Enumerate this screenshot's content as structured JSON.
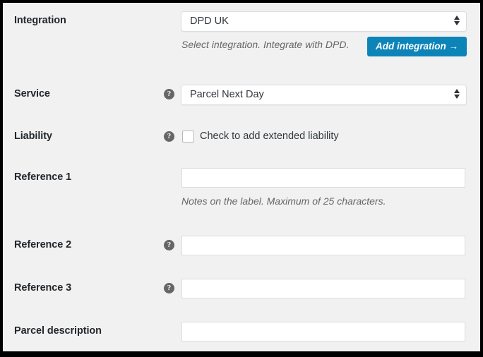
{
  "panel": {
    "background_color": "#f1f1f1",
    "accent_color": "#0d84b8"
  },
  "fields": {
    "integration": {
      "label": "Integration",
      "selected": "DPD UK",
      "description": "Select integration. Integrate with DPD.",
      "button_label": "Add integration →",
      "has_help": false
    },
    "service": {
      "label": "Service",
      "selected": "Parcel Next Day",
      "help_glyph": "?",
      "has_help": true
    },
    "liability": {
      "label": "Liability",
      "checkbox_label": "Check to add extended liability",
      "checked": false,
      "help_glyph": "?",
      "has_help": true
    },
    "reference1": {
      "label": "Reference 1",
      "value": "",
      "placeholder": "",
      "description": "Notes on the label. Maximum of 25 characters.",
      "has_help": false
    },
    "reference2": {
      "label": "Reference 2",
      "value": "",
      "placeholder": "",
      "help_glyph": "?",
      "has_help": true
    },
    "reference3": {
      "label": "Reference 3",
      "value": "",
      "placeholder": "",
      "help_glyph": "?",
      "has_help": true
    },
    "parcel_description": {
      "label": "Parcel description",
      "value": "",
      "placeholder": "",
      "has_help": false
    }
  }
}
